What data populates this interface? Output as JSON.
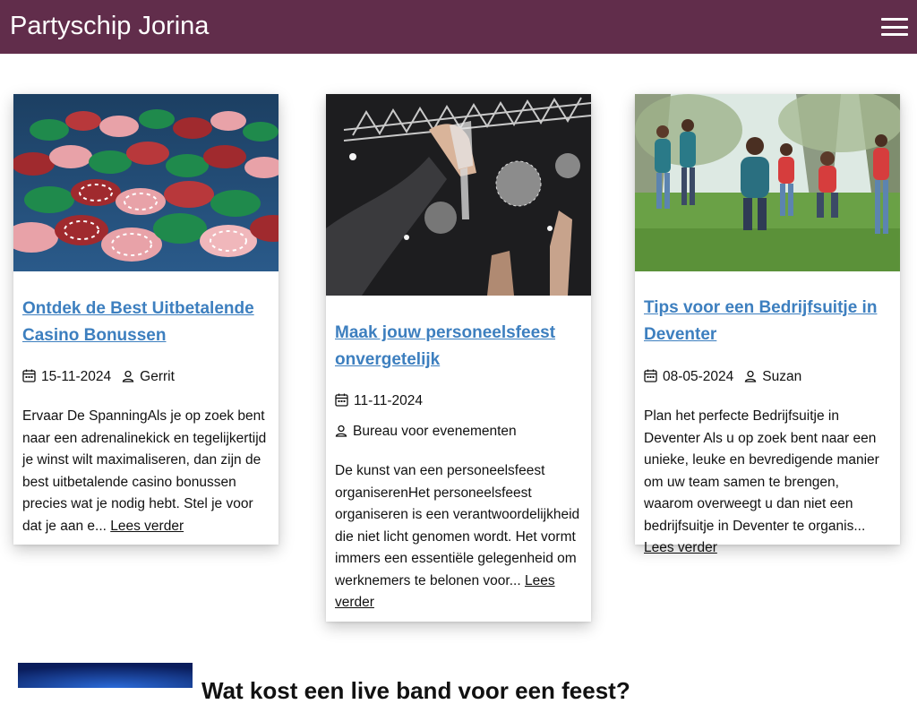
{
  "header": {
    "site_title": "Partyschip Jorina",
    "menu_icon": "hamburger-menu-icon",
    "background_color": "#612d4b"
  },
  "posts": [
    {
      "title": "Ontdek de Best Uitbetalende Casino Bonussen",
      "date": "15-11-2024",
      "author": "Gerrit",
      "excerpt": "Ervaar De SpanningAls je op zoek bent naar een adrenalinekick en tegelijkertijd je winst wilt maximaliseren, dan zijn de best uitbetalende casino bonussen precies wat je nodig hebt. Stel je voor dat je aan e...",
      "read_more": "Lees verder",
      "image": "casino-chips-photo"
    },
    {
      "title": "Maak jouw personeelsfeest onvergetelijk",
      "date": "11-11-2024",
      "author": "Bureau voor evenementen",
      "excerpt": "De kunst van een personeelsfeest organiserenHet personeelsfeest organiseren is een verantwoordelijkheid die niet licht genomen wordt. Het vormt immers een essentiële gelegenheid om werknemers te belonen voor...",
      "read_more": "Lees verder",
      "image": "party-champagne-disco-photo"
    },
    {
      "title": "Tips voor een Bedrijfsuitje in Deventer",
      "date": "08-05-2024",
      "author": "Suzan",
      "excerpt": "Plan het perfecte Bedrijfsuitje in Deventer Als u op zoek bent naar een unieke, leuke en bevredigende manier om uw team samen te brengen, waarom overweegt u dan niet een bedrijfsuitje in Deventer te organis...",
      "read_more": "Lees verder",
      "image": "team-outdoor-jumping-photo"
    }
  ],
  "next_section": {
    "title": "Wat kost een live band voor een feest?",
    "image": "blue-stage-photo"
  },
  "icons": {
    "date": "calendar-icon",
    "author": "person-icon"
  },
  "colors": {
    "link": "#3d7fbf",
    "text": "#111111"
  }
}
